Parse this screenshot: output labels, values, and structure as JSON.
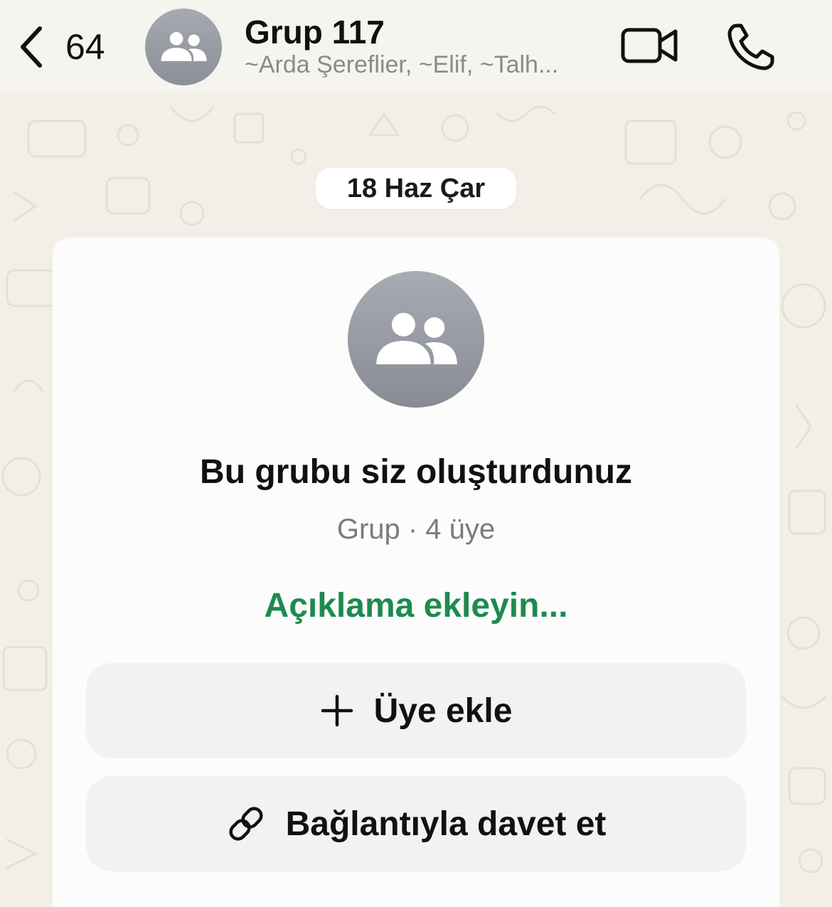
{
  "header": {
    "back_count": "64",
    "title": "Grup 117",
    "subtitle": "~Arda Şereflier, ~Elif, ~Talh...",
    "icons": [
      "chevron-left-icon",
      "group-icon",
      "video-call-icon",
      "phone-icon"
    ]
  },
  "chat": {
    "date_label": "18 Haz Çar"
  },
  "group_card": {
    "title": "Bu grubu siz oluşturdunuz",
    "meta": "Grup · 4 üye",
    "description_link": "Açıklama ekleyin...",
    "add_member_label": "Üye ekle",
    "invite_link_label": "Bağlantıyla davet et"
  },
  "colors": {
    "accent_green": "#1c8b4f",
    "avatar_gray": "#989ba3",
    "wallpaper": "#f3efe8"
  }
}
